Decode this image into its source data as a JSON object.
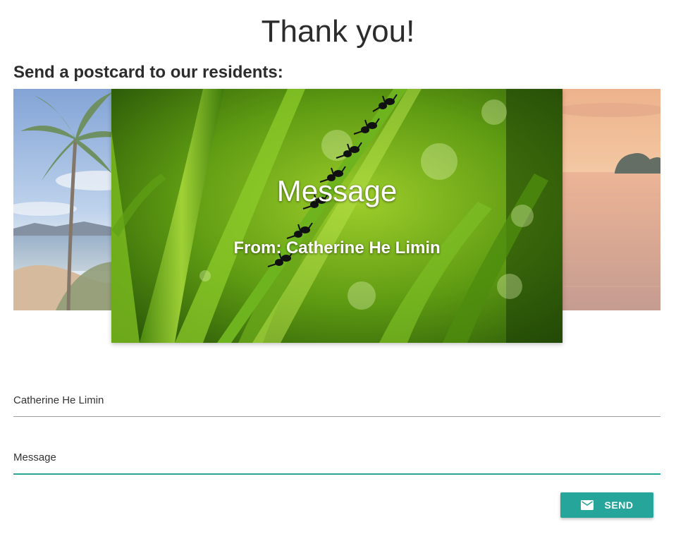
{
  "header": {
    "title": "Thank you!",
    "subtitle": "Send a postcard to our residents:"
  },
  "carousel": {
    "slides": [
      {
        "image": "tropical-beach-palm-photo"
      },
      {
        "image": "green-grass-ants-photo",
        "active": true
      },
      {
        "image": "sunset-sea-photo"
      }
    ],
    "card": {
      "message": "Message",
      "from": "From: Catherine He Limin"
    }
  },
  "form": {
    "name_value": "Catherine He Limin",
    "message_value": "Message",
    "send_label": "SEND",
    "send_icon": "email-icon"
  },
  "colors": {
    "accent": "#26a69a",
    "text": "#333333"
  }
}
